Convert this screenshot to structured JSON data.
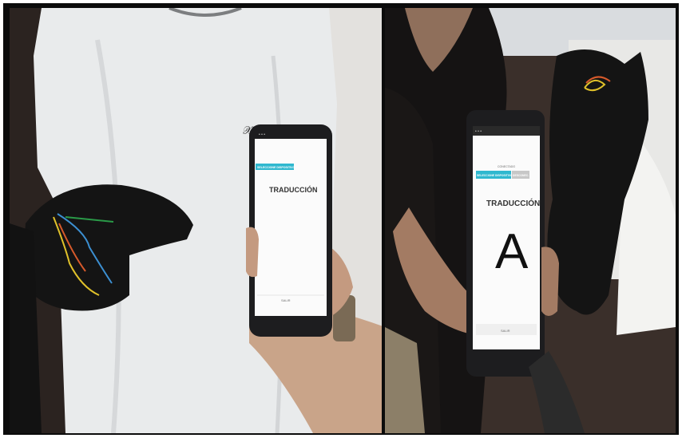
{
  "photos": [
    {
      "id": "left",
      "phone_screen": {
        "status_bar": "",
        "tab_label": "SELECCIONE DISPOSITIVO",
        "title": "TRADUCCIÓN",
        "letter": "",
        "bottom_button": "SALIR"
      }
    },
    {
      "id": "right",
      "phone_screen": {
        "status_bar": "",
        "small_label": "CONECTADO",
        "tab_label": "SELECCIONE DISPOSITIVO",
        "tab_label_2": "DESCONEC.",
        "title": "TRADUCCIÓN",
        "letter": "A",
        "bottom_button": "SALIR"
      }
    }
  ],
  "colors": {
    "accent": "#2fb8cf",
    "glove": "#141414",
    "shirt": "#e9ebec",
    "screen": "#fbfbfb"
  }
}
